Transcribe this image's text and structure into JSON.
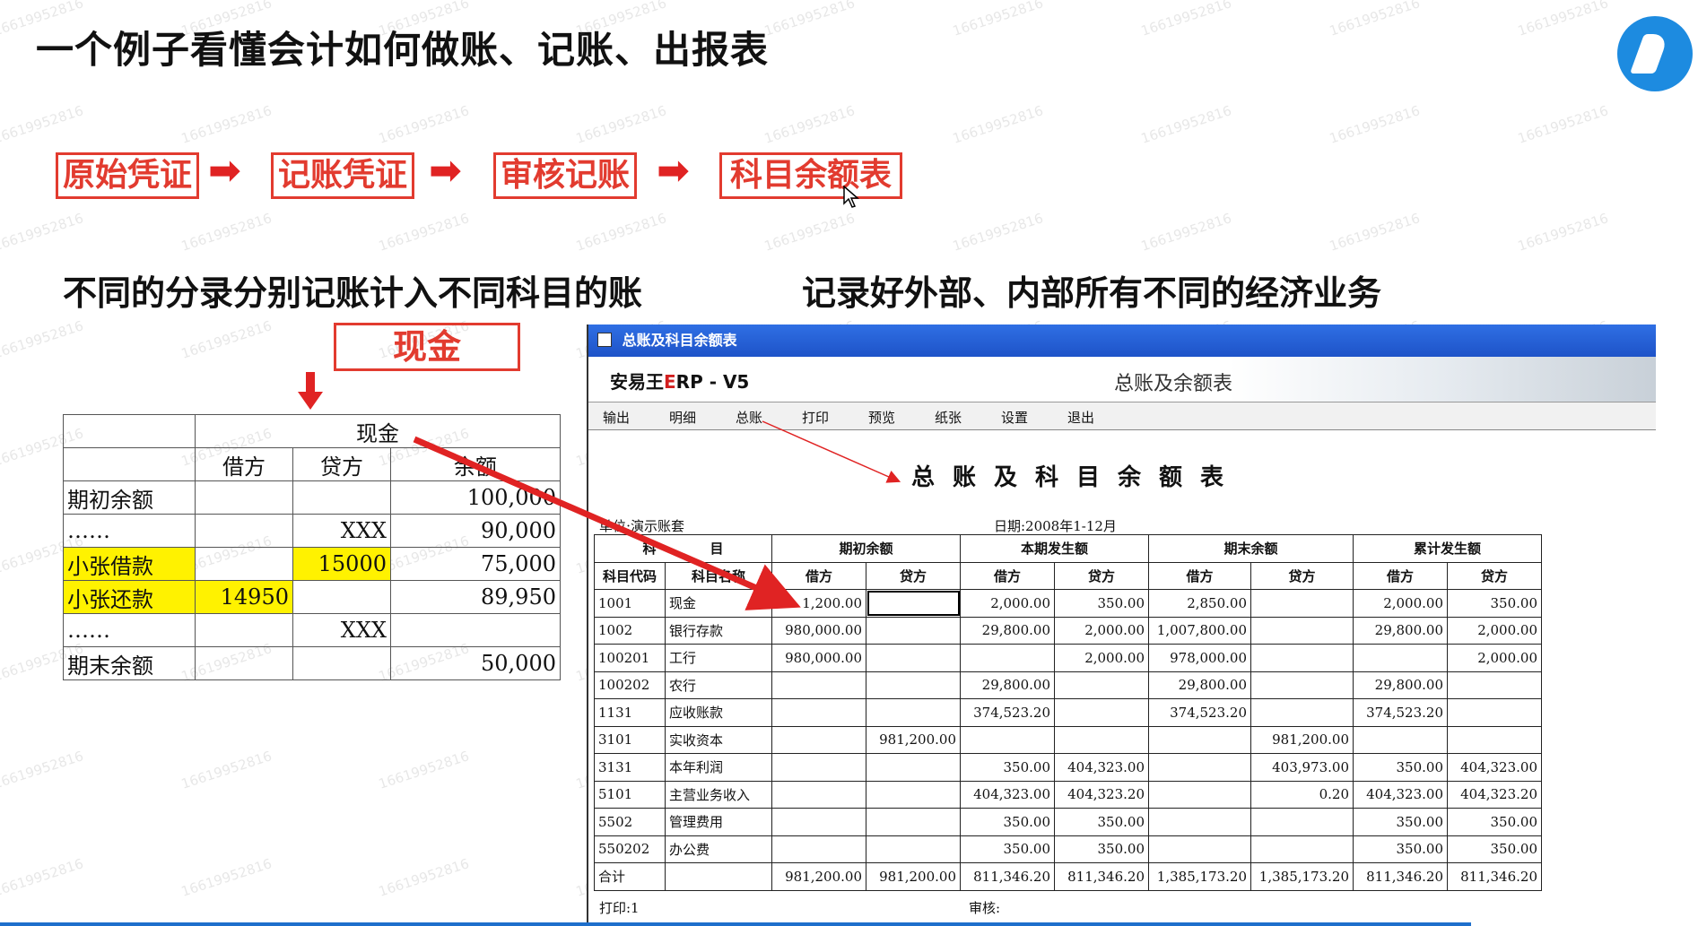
{
  "slide": {
    "title": "一个例子看懂会计如何做账、记账、出报表",
    "watermark": "16619952816",
    "flow": [
      "原始凭证",
      "记账凭证",
      "审核记账",
      "科目余额表"
    ],
    "flow_arrow": "➡",
    "caption_left": "不同的分录分别记账计入不同科目的账",
    "caption_right": "记录好外部、内部所有不同的经济业务",
    "cash_label": "现金"
  },
  "ledger": {
    "account": "现金",
    "headers": [
      "",
      "借方",
      "贷方",
      "余额"
    ],
    "rows": [
      {
        "label": "期初余额",
        "debit": "",
        "credit": "",
        "balance": "100,000",
        "highlight": false
      },
      {
        "label": "……",
        "debit": "",
        "credit": "XXX",
        "balance": "90,000",
        "highlight": false
      },
      {
        "label": "小张借款",
        "debit": "",
        "credit": "15000",
        "balance": "75,000",
        "highlight": true
      },
      {
        "label": "小张还款",
        "debit": "14950",
        "credit": "",
        "balance": "89,950",
        "highlight": true
      },
      {
        "label": "……",
        "debit": "",
        "credit": "XXX",
        "balance": "",
        "highlight": false
      },
      {
        "label": "期末余额",
        "debit": "",
        "credit": "",
        "balance": "50,000",
        "highlight": false
      }
    ]
  },
  "erp": {
    "window_title": "总账及科目余额表",
    "brand_prefix": "安易王",
    "brand_e": "E",
    "brand_suffix": "RP - V5",
    "header_subtitle": "总账及余额表",
    "menu": [
      "输出",
      "明细",
      "总账",
      "打印",
      "预览",
      "纸张",
      "设置",
      "退出"
    ],
    "report_title": "总账及科目余额表",
    "unit": "单位:演示账套",
    "date": "日期:2008年1-12月",
    "group_headers": [
      "科　　　　目",
      "期初余额",
      "本期发生额",
      "期末余额",
      "累计发生额"
    ],
    "sub_headers": [
      "科目代码",
      "科目名称",
      "借方",
      "贷方",
      "借方",
      "贷方",
      "借方",
      "贷方",
      "借方",
      "贷方"
    ],
    "rows": [
      [
        "1001",
        "现金",
        "1,200.00",
        "",
        "2,000.00",
        "350.00",
        "2,850.00",
        "",
        "2,000.00",
        "350.00"
      ],
      [
        "1002",
        "银行存款",
        "980,000.00",
        "",
        "29,800.00",
        "2,000.00",
        "1,007,800.00",
        "",
        "29,800.00",
        "2,000.00"
      ],
      [
        "100201",
        "工行",
        "980,000.00",
        "",
        "",
        "2,000.00",
        "978,000.00",
        "",
        "",
        "2,000.00"
      ],
      [
        "100202",
        "农行",
        "",
        "",
        "29,800.00",
        "",
        "29,800.00",
        "",
        "29,800.00",
        ""
      ],
      [
        "1131",
        "应收账款",
        "",
        "",
        "374,523.20",
        "",
        "374,523.20",
        "",
        "374,523.20",
        ""
      ],
      [
        "3101",
        "实收资本",
        "",
        "981,200.00",
        "",
        "",
        "",
        "981,200.00",
        "",
        ""
      ],
      [
        "3131",
        "本年利润",
        "",
        "",
        "350.00",
        "404,323.00",
        "",
        "403,973.00",
        "350.00",
        "404,323.00"
      ],
      [
        "5101",
        "主营业务收入",
        "",
        "",
        "404,323.00",
        "404,323.20",
        "",
        "0.20",
        "404,323.00",
        "404,323.20"
      ],
      [
        "5502",
        "管理费用",
        "",
        "",
        "350.00",
        "350.00",
        "",
        "",
        "350.00",
        "350.00"
      ],
      [
        "550202",
        "办公费",
        "",
        "",
        "350.00",
        "350.00",
        "",
        "",
        "350.00",
        "350.00"
      ],
      [
        "合计",
        "",
        "981,200.00",
        "981,200.00",
        "811,346.20",
        "811,346.20",
        "1,385,173.20",
        "1,385,173.20",
        "811,346.20",
        "811,346.20"
      ]
    ],
    "print_label": "打印:1",
    "audit_label": "审核:"
  },
  "colors": {
    "accent_red": "#e23b2f",
    "highlight_yellow": "#fff200",
    "titlebar_blue": "#1e53c8"
  }
}
